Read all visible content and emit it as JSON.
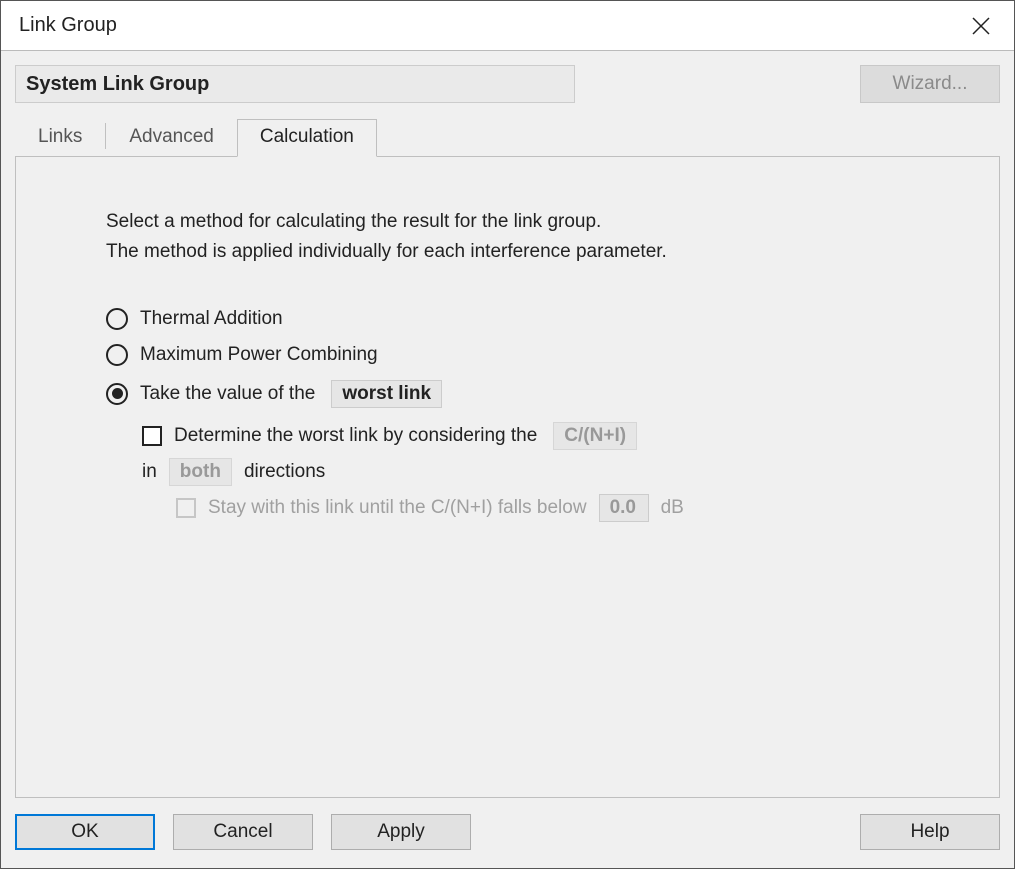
{
  "window": {
    "title": "Link Group"
  },
  "header": {
    "group_name": "System Link Group",
    "wizard_label": "Wizard..."
  },
  "tabs": {
    "links": "Links",
    "advanced": "Advanced",
    "calculation": "Calculation"
  },
  "panel": {
    "instruction1": "Select a method for calculating the result for the link group.",
    "instruction2": "The method is applied individually for each interference parameter.",
    "radio_thermal": "Thermal Addition",
    "radio_maxpower": "Maximum Power Combining",
    "radio_take_prefix": "Take the value of the",
    "worst_select": "worst link",
    "determine_prefix": "Determine the worst link by considering the",
    "criterion_select": "C/(N+I)",
    "in_label": "in",
    "direction_select": "both",
    "directions_label": "directions",
    "stay_prefix": "Stay with this link until the C/(N+I) falls below",
    "threshold_value": "0.0",
    "threshold_unit": "dB"
  },
  "footer": {
    "ok": "OK",
    "cancel": "Cancel",
    "apply": "Apply",
    "help": "Help"
  }
}
